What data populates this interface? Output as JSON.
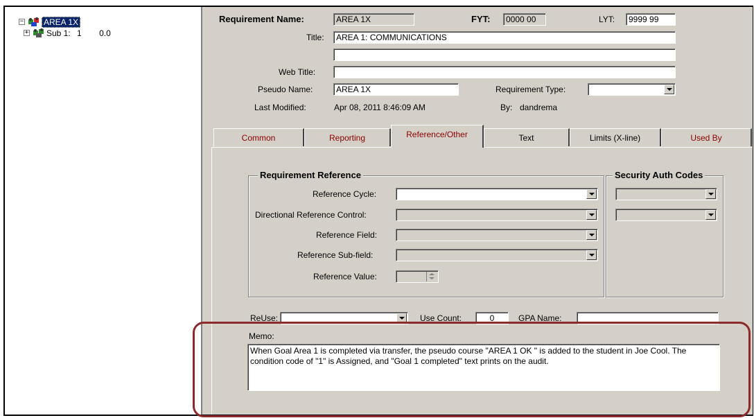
{
  "tree": {
    "root": {
      "label": "AREA 1X",
      "expander": "⊟"
    },
    "child": {
      "label": "Sub 1:",
      "num": "1",
      "val": "0.0",
      "expander": "+"
    },
    "node_icon": "group-people-icon"
  },
  "header": {
    "req_name_label": "Requirement Name:",
    "req_name_value": "AREA 1X",
    "fyt_label": "FYT:",
    "fyt_value": "0000 00",
    "lyt_label": "LYT:",
    "lyt_value": "9999 99",
    "title_label": "Title:",
    "title_value": "AREA 1:  COMMUNICATIONS",
    "title2_value": "",
    "web_title_label": "Web Title:",
    "web_title_value": "",
    "pseudo_label": "Pseudo Name:",
    "pseudo_value": "AREA 1X",
    "req_type_label": "Requirement Type:",
    "req_type_value": "",
    "last_modified_label": "Last Modified:",
    "last_modified_value": "Apr 08, 2011  8:46:09 AM",
    "by_label": "By:",
    "by_value": "dandrema"
  },
  "tabs": [
    {
      "label": "Common"
    },
    {
      "label": "Reporting"
    },
    {
      "label": "Reference/Other",
      "active": true
    },
    {
      "label": "Text"
    },
    {
      "label": "Limits (X-line)"
    },
    {
      "label": "Used By"
    }
  ],
  "reference": {
    "group_title": "Requirement Reference",
    "cycle_label": "Reference Cycle:",
    "cycle_value": "",
    "dir_label": "Directional Reference Control:",
    "dir_value": "",
    "field_label": "Reference Field:",
    "field_value": "",
    "subfield_label": "Reference Sub-field:",
    "subfield_value": "",
    "value_label": "Reference Value:",
    "value_value": ""
  },
  "security": {
    "group_title": "Security Auth Codes",
    "code1": "",
    "code2": ""
  },
  "bottom": {
    "reuse_label": "ReUse:",
    "reuse_value": "",
    "use_count_label": "Use Count:",
    "use_count_value": "0",
    "gpa_label": "GPA Name:",
    "gpa_value": "",
    "memo_label": "Memo:",
    "memo_text": "When Goal Area 1 is completed via transfer,  the pseudo course \"AREA 1 OK \" is added to the student in Joe Cool.  The condition code of \"1\" is Assigned, and \"Goal 1 completed\" text prints on the audit."
  },
  "colors": {
    "tab_text": "#8b0000",
    "highlight": "#8b2a2a",
    "selection": "#0a246a",
    "face": "#d4d0c8"
  }
}
